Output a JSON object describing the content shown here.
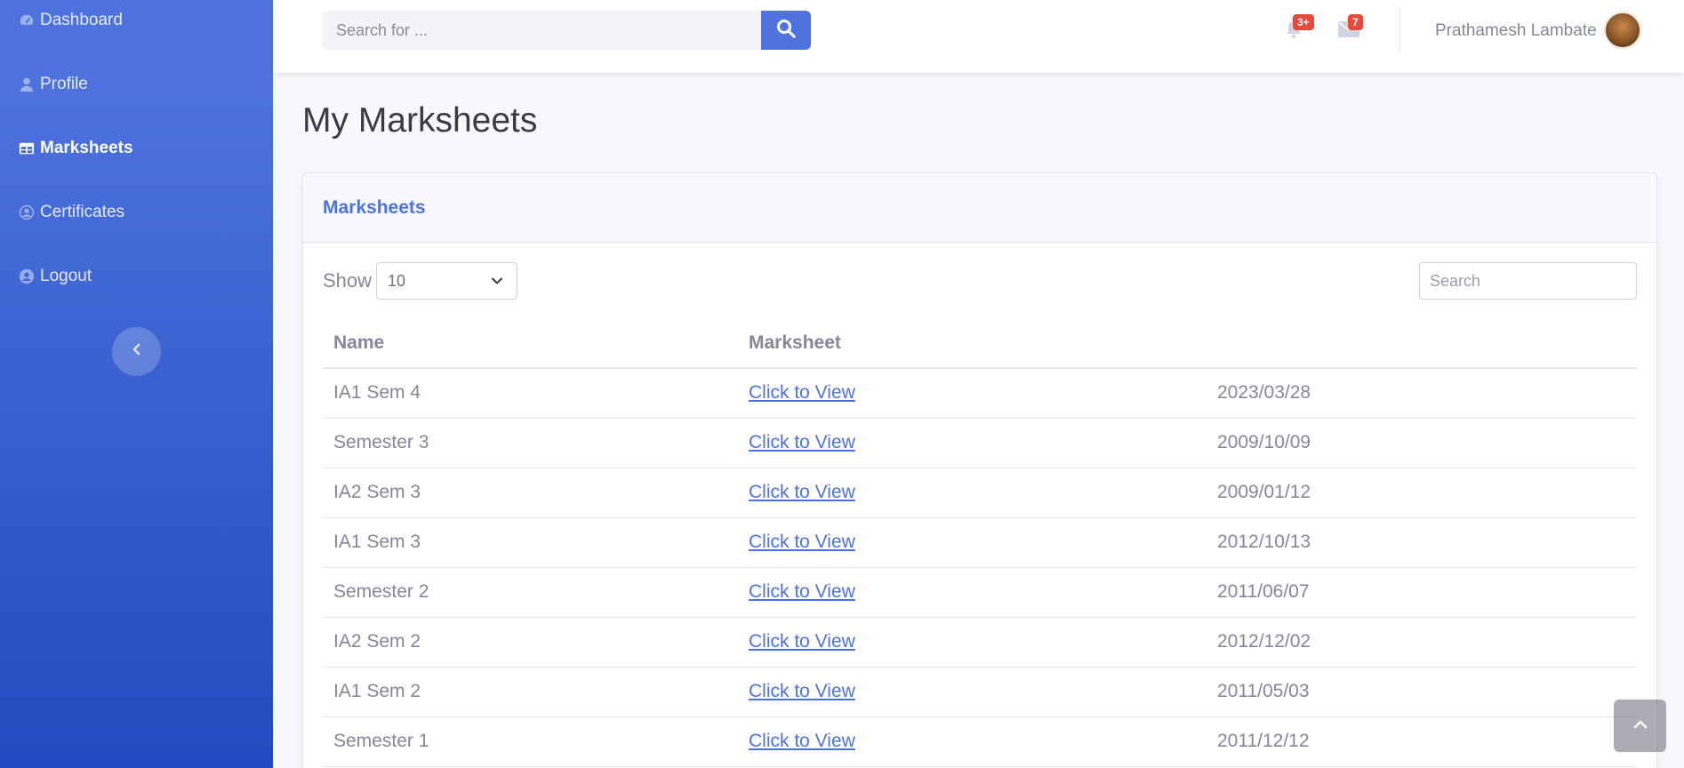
{
  "sidebar": {
    "items": [
      {
        "label": "Dashboard",
        "icon": "tachometer-icon"
      },
      {
        "label": "Profile",
        "icon": "user-icon"
      },
      {
        "label": "Marksheets",
        "icon": "table-icon",
        "active": true
      },
      {
        "label": "Certificates",
        "icon": "user-circle-icon"
      },
      {
        "label": "Logout",
        "icon": "user-circle-icon"
      }
    ],
    "toggle_icon": "chevron-left-icon"
  },
  "topbar": {
    "search_placeholder": "Search for ...",
    "alerts_badge": "3+",
    "messages_badge": "7",
    "user_name": "Prathamesh Lambate"
  },
  "main": {
    "page_title": "My Marksheets",
    "card_title": "Marksheets",
    "show_label": "Show",
    "show_value": "10",
    "table_search_placeholder": "Search",
    "columns": [
      "Name",
      "Marksheet",
      ""
    ],
    "rows": [
      {
        "name": "IA1 Sem 4",
        "link": "Click to View",
        "date": "2023/03/28"
      },
      {
        "name": "Semester 3",
        "link": "Click to View",
        "date": "2009/10/09"
      },
      {
        "name": "IA2 Sem 3",
        "link": "Click to View",
        "date": "2009/01/12"
      },
      {
        "name": "IA1 Sem 3",
        "link": "Click to View",
        "date": "2012/10/13"
      },
      {
        "name": "Semester 2",
        "link": "Click to View",
        "date": "2011/06/07"
      },
      {
        "name": "IA2 Sem 2",
        "link": "Click to View",
        "date": "2012/12/02"
      },
      {
        "name": "IA1 Sem 2",
        "link": "Click to View",
        "date": "2011/05/03"
      },
      {
        "name": "Semester 1",
        "link": "Click to View",
        "date": "2011/12/12"
      }
    ]
  },
  "colors": {
    "accent": "#4e73df",
    "badge": "#e74a3b",
    "sidebar_top": "#4e73df",
    "sidebar_bottom": "#224abe"
  }
}
